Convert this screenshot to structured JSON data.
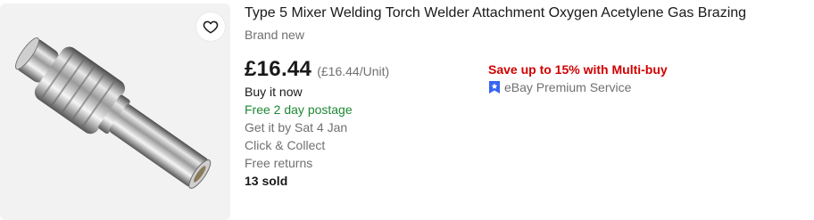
{
  "listing": {
    "title": "Type 5 Mixer Welding Torch Welder Attachment Oxygen Acetylene Gas Brazing",
    "condition": "Brand new",
    "price": "£16.44",
    "unit_price": "(£16.44/Unit)",
    "buying_format": "Buy it now",
    "shipping": "Free 2 day postage",
    "delivery": "Get it by Sat 4 Jan",
    "click_collect": "Click & Collect",
    "returns": "Free returns",
    "sold": "13 sold",
    "promo": "Save up to 15% with Multi-buy",
    "premium_service": "eBay Premium Service"
  },
  "icons": {
    "watch": "heart-icon",
    "premium": "premium-badge-icon"
  },
  "colors": {
    "shipping": "#1e8734",
    "promo": "#d00000",
    "premium_badge": "#3665f3",
    "secondary_text": "#707070"
  }
}
